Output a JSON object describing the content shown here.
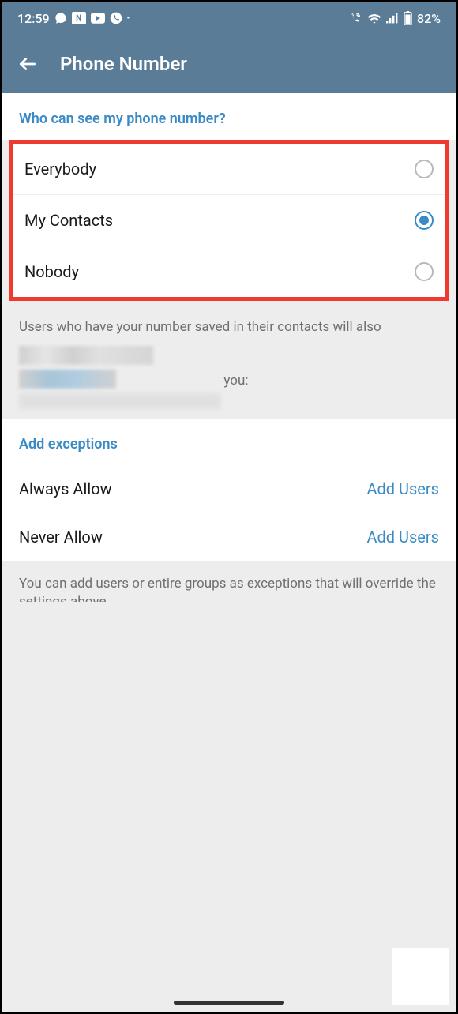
{
  "status": {
    "time": "12:59",
    "battery": "82%"
  },
  "header": {
    "title": "Phone Number"
  },
  "sections": {
    "visibility": {
      "header": "Who can see my phone number?",
      "options": [
        {
          "label": "Everybody",
          "selected": false
        },
        {
          "label": "My Contacts",
          "selected": true
        },
        {
          "label": "Nobody",
          "selected": false
        }
      ],
      "description_line1": "Users who have your number saved in their contacts will also",
      "you_fragment": "you:"
    },
    "exceptions": {
      "header": "Add exceptions",
      "items": [
        {
          "label": "Always Allow",
          "action": "Add Users"
        },
        {
          "label": "Never Allow",
          "action": "Add Users"
        }
      ],
      "footer": "You can add users or entire groups as exceptions that will override the settings above."
    }
  }
}
